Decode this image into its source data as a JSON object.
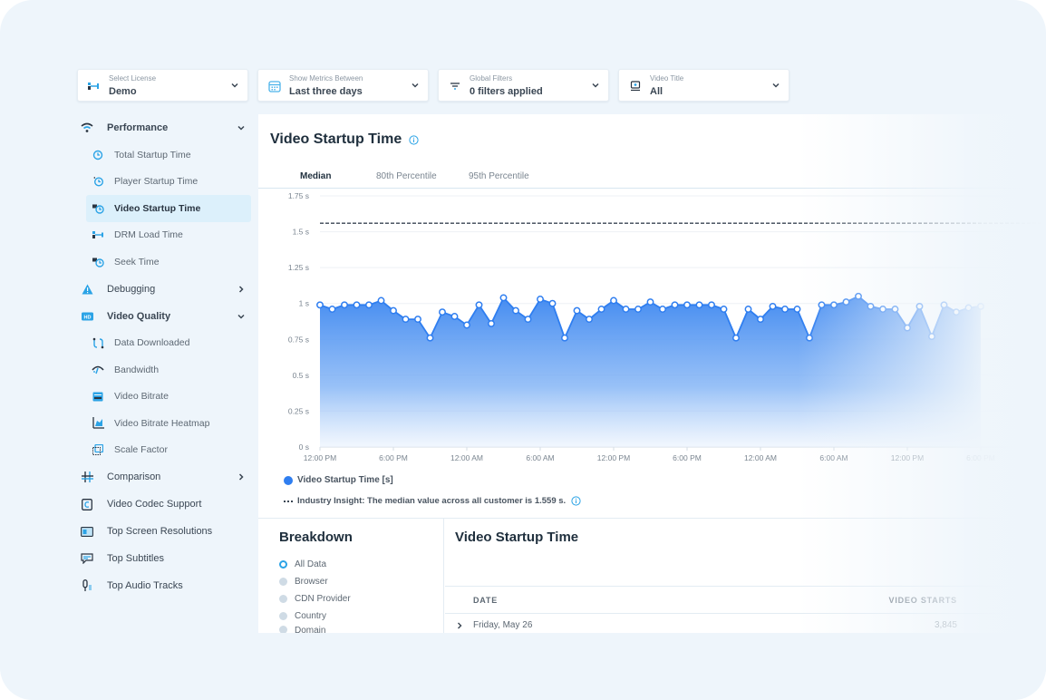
{
  "filters": [
    {
      "label": "Select License",
      "value": "Demo",
      "icon": "license-icon"
    },
    {
      "label": "Show Metrics Between",
      "value": "Last three days",
      "icon": "calendar-icon"
    },
    {
      "label": "Global Filters",
      "value": "0 filters applied",
      "icon": "filter-icon"
    },
    {
      "label": "Video Title",
      "value": "All",
      "icon": "video-title-icon"
    }
  ],
  "sidebar": {
    "performance": {
      "label": "Performance",
      "items": [
        {
          "label": "Total Startup Time",
          "icon": "clock-icon"
        },
        {
          "label": "Player Startup Time",
          "icon": "player-clock-icon"
        },
        {
          "label": "Video Startup Time",
          "icon": "video-clock-icon",
          "active": true
        },
        {
          "label": "DRM Load Time",
          "icon": "drm-key-icon"
        },
        {
          "label": "Seek Time",
          "icon": "seek-clock-icon"
        }
      ]
    },
    "debugging": {
      "label": "Debugging"
    },
    "video_quality": {
      "label": "Video Quality",
      "items": [
        {
          "label": "Data Downloaded",
          "icon": "data-download-icon"
        },
        {
          "label": "Bandwidth",
          "icon": "bandwidth-gauge-icon"
        },
        {
          "label": "Video Bitrate",
          "icon": "bitrate-icon"
        },
        {
          "label": "Video Bitrate Heatmap",
          "icon": "heatmap-icon"
        },
        {
          "label": "Scale Factor",
          "icon": "scale-factor-icon"
        }
      ]
    },
    "comparison": {
      "label": "Comparison"
    },
    "others": [
      {
        "label": "Video Codec Support",
        "icon": "codec-icon"
      },
      {
        "label": "Top Screen Resolutions",
        "icon": "screen-resolution-icon"
      },
      {
        "label": "Top Subtitles",
        "icon": "subtitles-icon"
      },
      {
        "label": "Top Audio Tracks",
        "icon": "audio-track-icon"
      }
    ]
  },
  "main": {
    "title": "Video Startup Time",
    "tabs": [
      {
        "label": "Median",
        "active": true
      },
      {
        "label": "80th Percentile"
      },
      {
        "label": "95th Percentile"
      }
    ],
    "legend_label": "Video Startup Time [s]",
    "insight_text": "Industry Insight: The median value across all customer is 1.559 s."
  },
  "chart_data": {
    "type": "area",
    "title": "Video Startup Time",
    "xlabel": "",
    "ylabel": "",
    "ylim": [
      0,
      1.75
    ],
    "yticks": [
      0,
      0.25,
      0.5,
      0.75,
      1,
      1.25,
      1.5,
      1.75
    ],
    "ytick_labels": [
      "0 s",
      "0.25 s",
      "0.5 s",
      "0.75 s",
      "1 s",
      "1.25 s",
      "1.5 s",
      "1.75 s"
    ],
    "xtick_labels": [
      "12:00 PM",
      "6:00 PM",
      "12:00 AM",
      "6:00 AM",
      "12:00 PM",
      "6:00 PM",
      "12:00 AM",
      "6:00 AM",
      "12:00 PM",
      "6:00 PM"
    ],
    "points_per_tick": 6,
    "grid": true,
    "legend": "bottom-left",
    "reference_line": {
      "label": "Industry Insight median",
      "value": 1.559,
      "style": "dashed"
    },
    "series": [
      {
        "name": "Video Startup Time [s]",
        "color": "#2f7ef0",
        "values": [
          0.99,
          0.96,
          0.99,
          0.99,
          0.99,
          1.02,
          0.95,
          0.89,
          0.89,
          0.76,
          0.94,
          0.91,
          0.85,
          0.99,
          0.86,
          1.04,
          0.95,
          0.89,
          1.03,
          1.0,
          0.76,
          0.95,
          0.89,
          0.96,
          1.02,
          0.96,
          0.96,
          1.01,
          0.96,
          0.99,
          0.99,
          0.99,
          0.99,
          0.96,
          0.76,
          0.96,
          0.89,
          0.98,
          0.96,
          0.96,
          0.76,
          0.99,
          0.99,
          1.01,
          1.05,
          0.98,
          0.96,
          0.96,
          0.83,
          0.98,
          0.77,
          0.99,
          0.94,
          0.97,
          0.98
        ]
      }
    ]
  },
  "breakdown": {
    "title": "Breakdown",
    "options": [
      {
        "label": "All Data",
        "checked": true
      },
      {
        "label": "Browser"
      },
      {
        "label": "CDN Provider"
      },
      {
        "label": "Country"
      },
      {
        "label": "Domain"
      }
    ]
  },
  "table": {
    "title": "Video Startup Time",
    "columns": [
      "DATE",
      "VIDEO STARTS"
    ],
    "rows": [
      {
        "date": "Friday, May 26",
        "video_starts": "3,845"
      }
    ]
  }
}
